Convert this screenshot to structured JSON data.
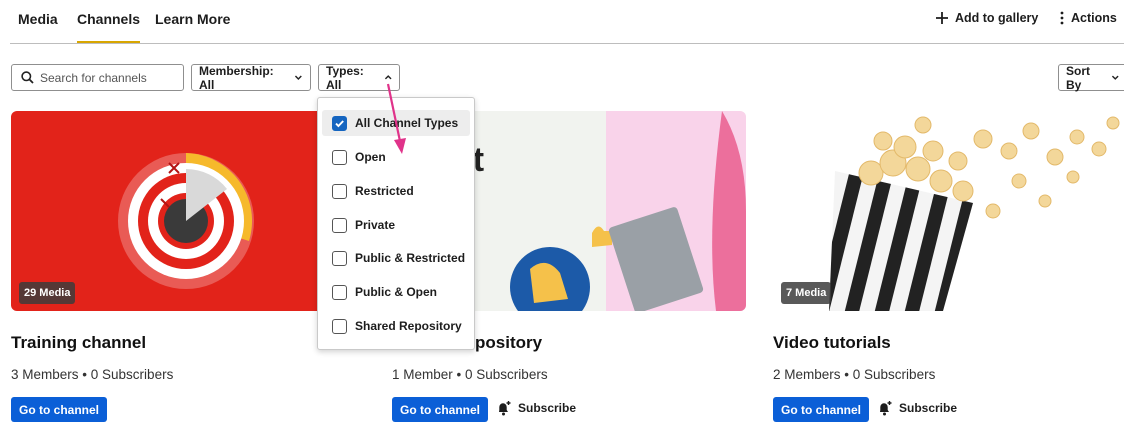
{
  "nav": {
    "tabs": [
      {
        "label": "Media",
        "active": false
      },
      {
        "label": "Channels",
        "active": true
      },
      {
        "label": "Learn More",
        "active": false
      }
    ],
    "add_to_gallery": "Add to gallery",
    "actions": "Actions",
    "accent_color": "#d8a600"
  },
  "filters": {
    "search_placeholder": "Search for channels",
    "membership": "Membership: All",
    "types": "Types: All",
    "sort": "Sort By"
  },
  "types_dropdown": {
    "options": [
      {
        "label": "All Channel Types",
        "checked": true
      },
      {
        "label": "Open",
        "checked": false
      },
      {
        "label": "Restricted",
        "checked": false
      },
      {
        "label": "Private",
        "checked": false
      },
      {
        "label": "Public & Restricted",
        "checked": false
      },
      {
        "label": "Public & Open",
        "checked": false
      },
      {
        "label": "Shared Repository",
        "checked": false
      }
    ],
    "checkbox_color": "#1565c0"
  },
  "cards": [
    {
      "title": "Training channel",
      "members": "3 Members",
      "subscribers": "0 Subscribers",
      "badge": "29 Media",
      "go_label": "Go to channel",
      "subscribe_label": ""
    },
    {
      "title": "pository",
      "members": "1 Member",
      "subscribers": "0 Subscribers",
      "badge": "",
      "thumb_text": "ot",
      "go_label": "Go to channel",
      "subscribe_label": "Subscribe"
    },
    {
      "title": "Video tutorials",
      "members": "2 Members",
      "subscribers": "0 Subscribers",
      "badge": "7 Media",
      "go_label": "Go to channel",
      "subscribe_label": "Subscribe"
    }
  ],
  "button_color": "#0b5fd7",
  "annotation_arrow_color": "#e0338a"
}
